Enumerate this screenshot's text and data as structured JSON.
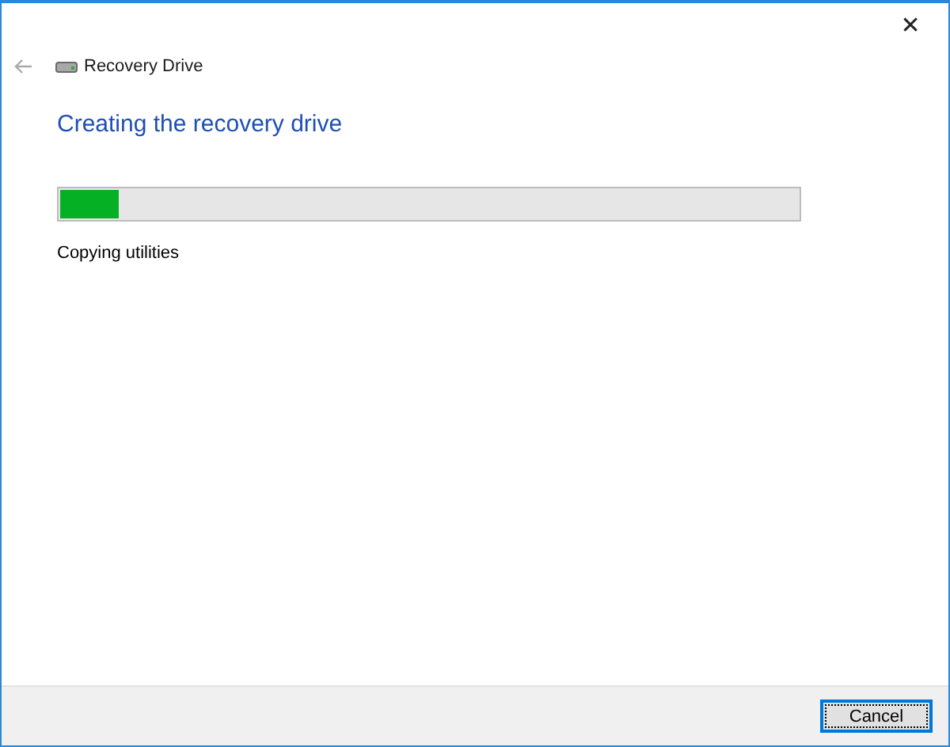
{
  "window": {
    "title": "Recovery Drive",
    "close": "✕"
  },
  "back_button": {
    "disabled": true
  },
  "heading": "Creating the recovery drive",
  "progress": {
    "level": 0.08,
    "status": "Copying utilities"
  },
  "buttons": [
    {
      "label": "Cancel",
      "focused": true
    }
  ]
}
